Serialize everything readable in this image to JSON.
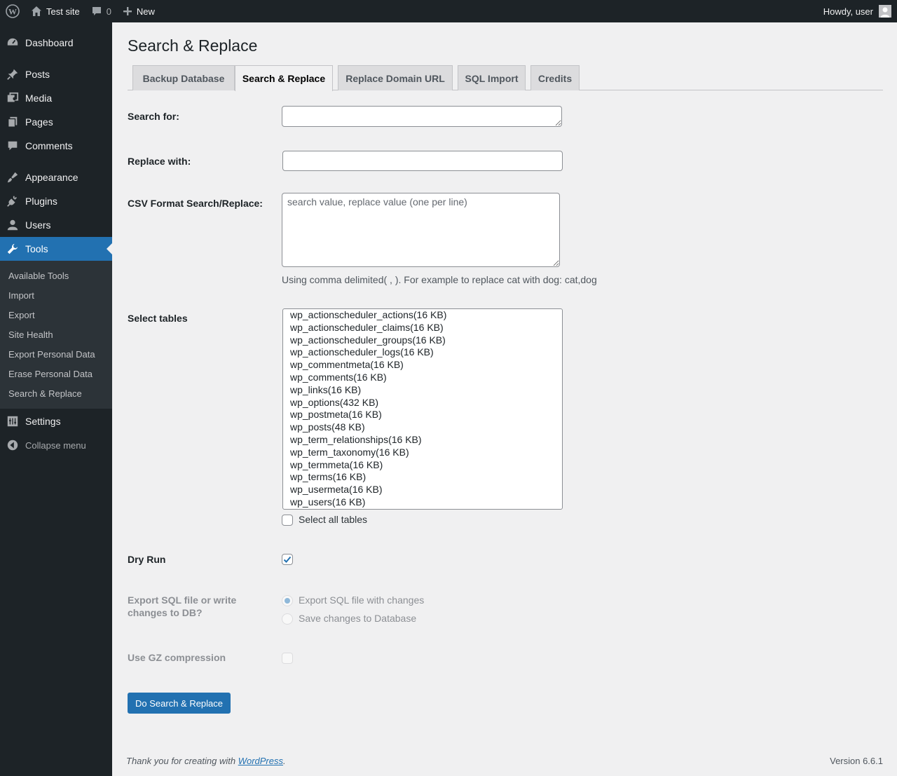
{
  "adminbar": {
    "site_name": "Test site",
    "comments_count": "0",
    "new_label": "New",
    "howdy": "Howdy, user"
  },
  "sidebar": {
    "items": [
      {
        "label": "Dashboard",
        "icon": "dashboard-icon"
      },
      {
        "label": "Posts",
        "icon": "pin-icon"
      },
      {
        "label": "Media",
        "icon": "media-icon"
      },
      {
        "label": "Pages",
        "icon": "pages-icon"
      },
      {
        "label": "Comments",
        "icon": "comment-icon"
      },
      {
        "label": "Appearance",
        "icon": "brush-icon"
      },
      {
        "label": "Plugins",
        "icon": "plug-icon"
      },
      {
        "label": "Users",
        "icon": "user-icon"
      },
      {
        "label": "Tools",
        "icon": "wrench-icon"
      },
      {
        "label": "Settings",
        "icon": "settings-icon"
      }
    ],
    "tools_submenu": [
      "Available Tools",
      "Import",
      "Export",
      "Site Health",
      "Export Personal Data",
      "Erase Personal Data",
      "Search & Replace"
    ],
    "collapse_label": "Collapse menu"
  },
  "page": {
    "title": "Search & Replace",
    "tabs": [
      "Backup Database",
      "Search & Replace",
      "Replace Domain URL",
      "SQL Import",
      "Credits"
    ],
    "active_tab": "Search & Replace"
  },
  "form": {
    "search_label": "Search for:",
    "search_value": "",
    "replace_label": "Replace with:",
    "replace_value": "",
    "csv_label": "CSV Format Search/Replace:",
    "csv_placeholder": "search value, replace value (one per line)",
    "csv_hint": "Using comma delimited( , ). For example to replace cat with dog: cat,dog",
    "tables_label": "Select tables",
    "tables": [
      "wp_actionscheduler_actions(16 KB)",
      "wp_actionscheduler_claims(16 KB)",
      "wp_actionscheduler_groups(16 KB)",
      "wp_actionscheduler_logs(16 KB)",
      "wp_commentmeta(16 KB)",
      "wp_comments(16 KB)",
      "wp_links(16 KB)",
      "wp_options(432 KB)",
      "wp_postmeta(16 KB)",
      "wp_posts(48 KB)",
      "wp_term_relationships(16 KB)",
      "wp_term_taxonomy(16 KB)",
      "wp_termmeta(16 KB)",
      "wp_terms(16 KB)",
      "wp_usermeta(16 KB)",
      "wp_users(16 KB)"
    ],
    "select_all_label": "Select all tables",
    "select_all_checked": false,
    "dry_run_label": "Dry Run",
    "dry_run_checked": true,
    "export_label_line1": "Export SQL file or write",
    "export_label_line2": "changes to DB?",
    "export_option_file": "Export SQL file with changes",
    "export_option_db": "Save changes to Database",
    "export_selected": "Export SQL file with changes",
    "gz_label": "Use GZ compression",
    "gz_checked": false,
    "submit_label": "Do Search & Replace"
  },
  "footer": {
    "thanks_prefix": "Thank you for creating with ",
    "thanks_link": "WordPress",
    "thanks_suffix": ".",
    "version": "Version 6.6.1"
  },
  "colors": {
    "admin_dark": "#1d2327",
    "accent": "#2271b1",
    "background": "#f0f0f1"
  }
}
